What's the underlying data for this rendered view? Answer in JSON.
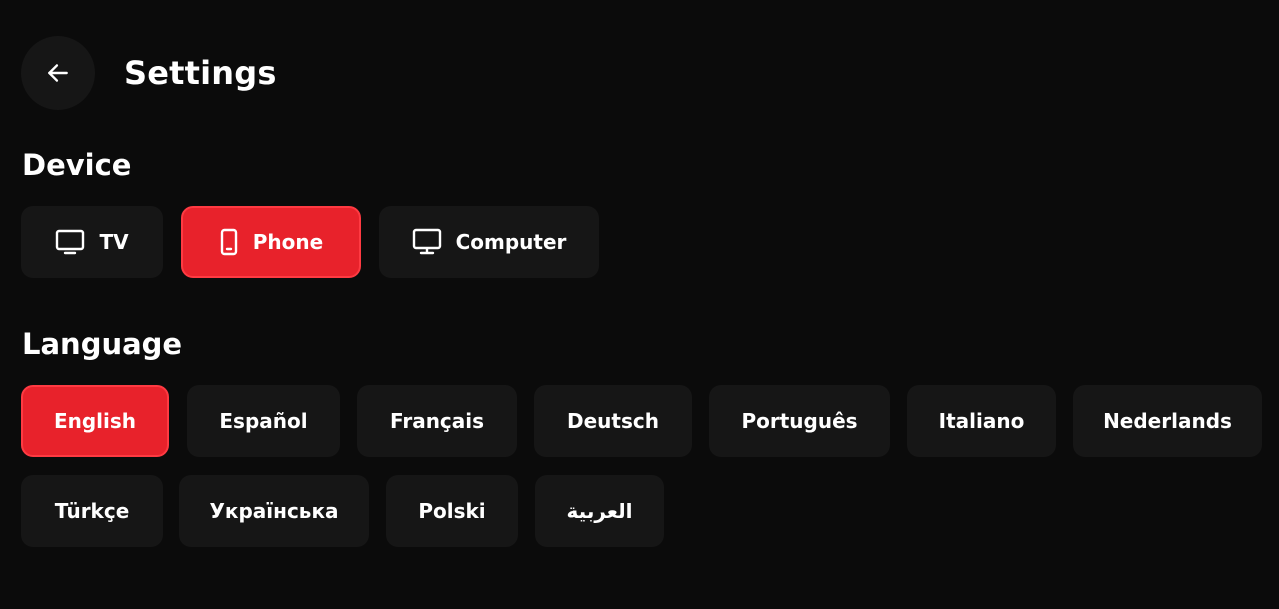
{
  "header": {
    "back_icon": "arrow-left-icon",
    "title": "Settings"
  },
  "device": {
    "title": "Device",
    "options": [
      {
        "label": "TV",
        "icon": "tv-icon",
        "selected": false
      },
      {
        "label": "Phone",
        "icon": "phone-icon",
        "selected": true
      },
      {
        "label": "Computer",
        "icon": "monitor-icon",
        "selected": false
      }
    ]
  },
  "language": {
    "title": "Language",
    "options": [
      {
        "label": "English",
        "selected": true
      },
      {
        "label": "Español",
        "selected": false
      },
      {
        "label": "Français",
        "selected": false
      },
      {
        "label": "Deutsch",
        "selected": false
      },
      {
        "label": "Português",
        "selected": false
      },
      {
        "label": "Italiano",
        "selected": false
      },
      {
        "label": "Nederlands",
        "selected": false
      },
      {
        "label": "Türkçe",
        "selected": false
      },
      {
        "label": "Українська",
        "selected": false
      },
      {
        "label": "Polski",
        "selected": false
      },
      {
        "label": "العربية",
        "selected": false
      }
    ]
  },
  "colors": {
    "background": "#0b0b0b",
    "chip": "#161616",
    "accent": "#e8222b",
    "text": "#ffffff"
  }
}
